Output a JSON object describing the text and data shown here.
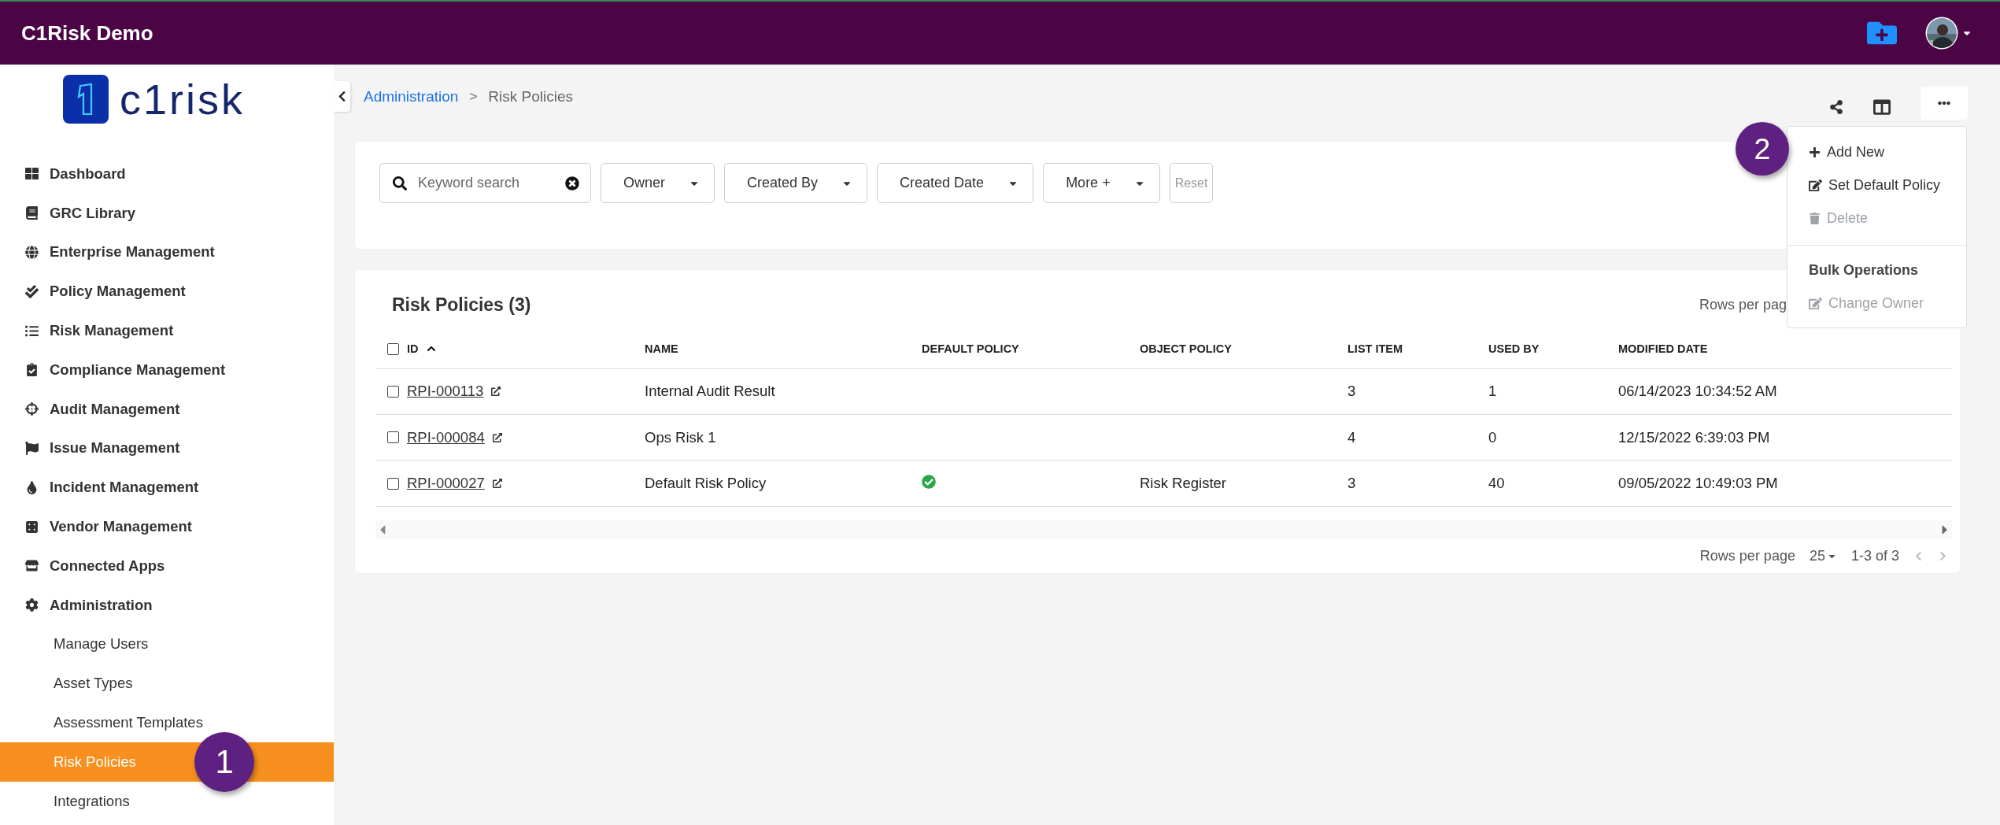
{
  "header": {
    "title": "C1Risk Demo"
  },
  "logo": {
    "text": "c1risk"
  },
  "sidebar": {
    "items": [
      {
        "label": "Dashboard",
        "selected": false
      },
      {
        "label": "GRC Library",
        "selected": false
      },
      {
        "label": "Enterprise Management",
        "selected": false
      },
      {
        "label": "Policy Management",
        "selected": false
      },
      {
        "label": "Risk Management",
        "selected": false
      },
      {
        "label": "Compliance Management",
        "selected": false
      },
      {
        "label": "Audit Management",
        "selected": false
      },
      {
        "label": "Issue Management",
        "selected": false
      },
      {
        "label": "Incident Management",
        "selected": false
      },
      {
        "label": "Vendor Management",
        "selected": false
      },
      {
        "label": "Connected Apps",
        "selected": false
      },
      {
        "label": "Administration",
        "selected": false,
        "children": [
          {
            "label": "Manage Users",
            "selected": false
          },
          {
            "label": "Asset Types",
            "selected": false
          },
          {
            "label": "Assessment Templates",
            "selected": false
          },
          {
            "label": "Risk Policies",
            "selected": true,
            "callout": "1"
          },
          {
            "label": "Integrations",
            "selected": false
          }
        ]
      }
    ]
  },
  "breadcrumb": {
    "separator": ">",
    "items": [
      {
        "label": "Administration",
        "kind": "link"
      },
      {
        "label": "Risk Policies",
        "kind": "current"
      }
    ]
  },
  "filters": {
    "search": {
      "placeholder": "Keyword search"
    },
    "dropdowns": [
      "Owner",
      "Created By",
      "Created Date",
      "More +"
    ],
    "reset": {
      "label": "Reset",
      "disabled": true
    }
  },
  "table": {
    "title": "Risk Policies (3)",
    "rows_per_page_top": "Rows per pag",
    "all_checked": false,
    "columns": [
      {
        "label": "ID",
        "sorted": true
      },
      {
        "label": "NAME",
        "sorted": false
      },
      {
        "label": "DEFAULT POLICY",
        "sorted": false
      },
      {
        "label": "OBJECT POLICY",
        "sorted": false
      },
      {
        "label": "LIST ITEM",
        "sorted": false
      },
      {
        "label": "USED BY",
        "sorted": false
      },
      {
        "label": "MODIFIED DATE",
        "sorted": false
      }
    ],
    "rows": [
      {
        "id": "RPI-000113",
        "name": "Internal Audit Result",
        "default_policy": false,
        "list_item": "3",
        "used_by": "1",
        "modified": "06/14/2023 10:34:52 AM",
        "selected": false
      },
      {
        "id": "RPI-000084",
        "name": "Ops Risk 1",
        "default_policy": false,
        "list_item": "4",
        "used_by": "0",
        "modified": "12/15/2022 6:39:03 PM",
        "selected": false
      },
      {
        "id": "RPI-000027",
        "name": "Default Risk Policy",
        "default_policy": true,
        "object_policy": "Risk Register",
        "list_item": "3",
        "used_by": "40",
        "modified": "09/05/2022 10:49:03 PM",
        "selected": false
      }
    ],
    "pagination": {
      "label": "Rows per page",
      "page_size": "25",
      "range": "1-3 of 3"
    }
  },
  "menu": {
    "callout": "2",
    "items": [
      {
        "label": "Add New",
        "kind": "add",
        "disabled": false
      },
      {
        "label": "Set Default Policy",
        "kind": "edit",
        "disabled": false
      },
      {
        "label": "Delete",
        "kind": "delete",
        "disabled": true
      }
    ],
    "section_title": "Bulk Operations",
    "bulk_items": [
      {
        "label": "Change Owner",
        "kind": "edit",
        "disabled": true
      }
    ]
  }
}
